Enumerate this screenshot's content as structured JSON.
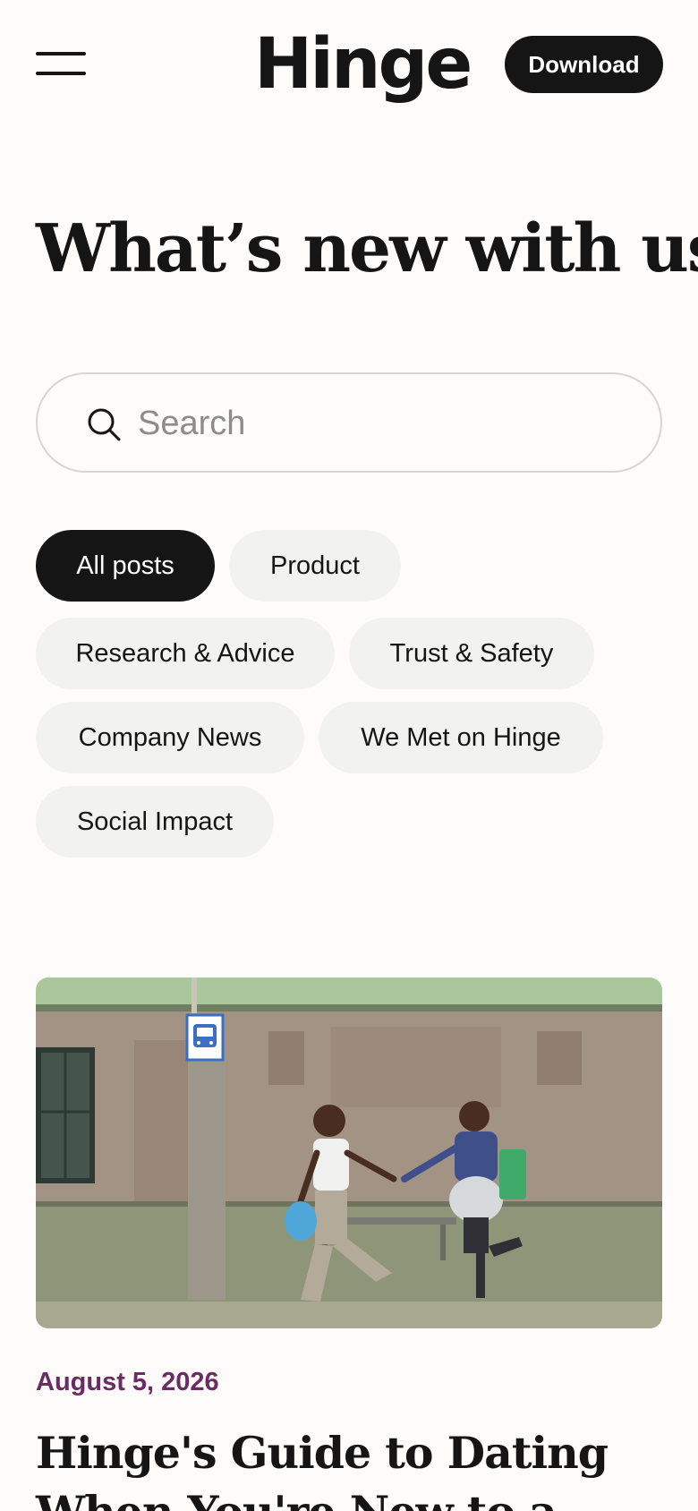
{
  "header": {
    "logo_text": "Hinge",
    "download_label": "Download"
  },
  "page": {
    "title": "What’s new with us"
  },
  "search": {
    "placeholder": "Search"
  },
  "filters": [
    {
      "label": "All posts",
      "active": true
    },
    {
      "label": "Product",
      "active": false
    },
    {
      "label": "Research & Advice",
      "active": false
    },
    {
      "label": "Trust & Safety",
      "active": false
    },
    {
      "label": "Company News",
      "active": false
    },
    {
      "label": "We Met on Hinge",
      "active": false
    },
    {
      "label": "Social Impact",
      "active": false
    }
  ],
  "article": {
    "date": "August 5, 2026",
    "title": "Hinge's Guide to Dating When You're New to a"
  },
  "colors": {
    "primary": "#151515",
    "chip_bg": "#f2f2f0",
    "date_accent": "#6b2c64",
    "background": "#fdfcfb"
  },
  "icons": {
    "menu": "hamburger-menu-icon",
    "search": "search-icon",
    "bus_sign": "bus-stop-icon"
  }
}
